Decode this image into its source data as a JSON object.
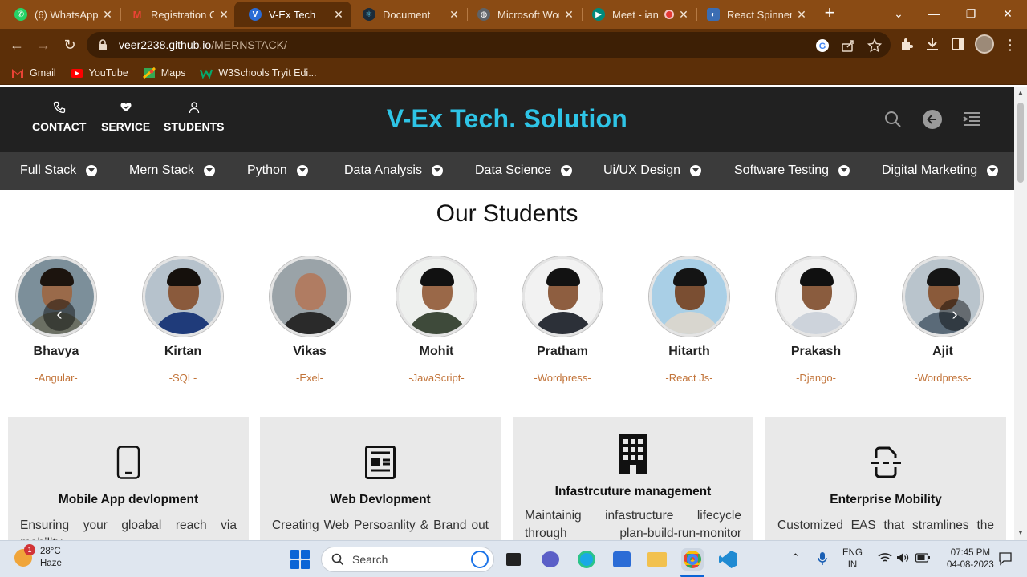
{
  "browser": {
    "tabs": [
      {
        "title": "(6) WhatsApp",
        "active": false,
        "favicon": "whatsapp-icon",
        "color": "#25d366"
      },
      {
        "title": "Registration Co",
        "active": false,
        "favicon": "gmail-icon",
        "color": "#ea4335"
      },
      {
        "title": "V-Ex Tech",
        "active": true,
        "favicon": "react-icon",
        "color": "#2b6cd6"
      },
      {
        "title": "Document",
        "active": false,
        "favicon": "react-icon",
        "color": "#1b2b3a"
      },
      {
        "title": "Microsoft Wor",
        "active": false,
        "favicon": "globe-icon",
        "color": "#5f6368"
      },
      {
        "title": "Meet - ian",
        "active": false,
        "favicon": "meet-icon",
        "color": "#00897b"
      },
      {
        "title": "React Spinners",
        "active": false,
        "favicon": "react-spinners-icon",
        "color": "#3b6db3"
      }
    ],
    "url_host": "veer2238.github.io",
    "url_path": "/MERNSTACK/",
    "bookmarks": [
      {
        "label": "Gmail",
        "icon": "gmail-icon"
      },
      {
        "label": "YouTube",
        "icon": "youtube-icon"
      },
      {
        "label": "Maps",
        "icon": "maps-icon"
      },
      {
        "label": "W3Schools Tryit Edi...",
        "icon": "w3schools-icon"
      }
    ],
    "theme_color": "#5c2f08"
  },
  "site": {
    "header_links": [
      {
        "label": "CONTACT",
        "icon": "phone-icon"
      },
      {
        "label": "SERVICE",
        "icon": "heart-hand-icon"
      },
      {
        "label": "STUDENTS",
        "icon": "person-icon"
      }
    ],
    "brand": "V-Ex Tech. Solution",
    "brand_color": "#2ec4e6",
    "categories": [
      "Full Stack",
      "Mern Stack",
      "Python",
      "Data Analysis",
      "Data Science",
      "Ui/UX Design",
      "Software Testing",
      "Digital Marketing"
    ],
    "students_title": "Our Students",
    "students": [
      {
        "name": "Bhavya",
        "skill": "-Angular-"
      },
      {
        "name": "Kirtan",
        "skill": "-SQL-"
      },
      {
        "name": "Vikas",
        "skill": "-Exel-"
      },
      {
        "name": "Mohit",
        "skill": "-JavaScript-"
      },
      {
        "name": "Pratham",
        "skill": "-Wordpress-"
      },
      {
        "name": "Hitarth",
        "skill": "-React Js-"
      },
      {
        "name": "Prakash",
        "skill": "-Django-"
      },
      {
        "name": "Ajit",
        "skill": "-Wordpress-"
      }
    ],
    "services": [
      {
        "title": "Mobile App devlopment",
        "text": "Ensuring your gloabal reach via mobility",
        "icon": "mobile-icon"
      },
      {
        "title": "Web Devlopment",
        "text": "Creating Web Persoanlity & Brand out",
        "icon": "newspaper-icon"
      },
      {
        "title": "Infastrcuture management",
        "text": "Maintainig infastructure lifecycle through plan-build-run-monitor",
        "icon": "building-icon"
      },
      {
        "title": "Enterprise Mobility",
        "text": "Customized EAS that stramlines the",
        "icon": "scan-document-icon"
      }
    ]
  },
  "taskbar": {
    "weather_temp": "28°C",
    "weather_desc": "Haze",
    "weather_badge": "1",
    "search_label": "Search",
    "lang_top": "ENG",
    "lang_bottom": "IN",
    "time": "07:45 PM",
    "date": "04-08-2023"
  }
}
